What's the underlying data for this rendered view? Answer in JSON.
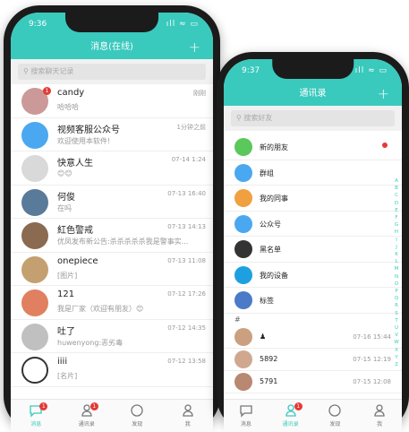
{
  "left_phone": {
    "status": {
      "time": "9:36",
      "signals": "ıll ≈ ▭"
    },
    "header": {
      "title": "消息(在线)",
      "add_label": "+"
    },
    "search": {
      "placeholder": "搜索聊天记录"
    },
    "conversations": [
      {
        "name": "candy",
        "message": "哈哈哈",
        "time": "刚刚",
        "badge": "1",
        "avatar_color": "#c99",
        "avatar": "person-photo"
      },
      {
        "name": "视频客服公众号",
        "message": "欢迎使用本软件!",
        "time": "1分钟之前",
        "badge": "",
        "avatar_color": "#4aa8f0",
        "avatar": "megaphone-icon"
      },
      {
        "name": "快意人生",
        "message": "😊😊",
        "time": "07-14 1:24",
        "badge": "",
        "avatar_color": "#d9d9d9",
        "avatar": "default-avatar"
      },
      {
        "name": "何俊",
        "message": "在吗",
        "time": "07-13 16:40",
        "badge": "",
        "avatar_color": "#5a7a9a",
        "avatar": "person-photo"
      },
      {
        "name": "紅色警戒",
        "message": "优凤发布新公告:杀杀杀杀杀我是警事实...",
        "time": "07-13 14:13",
        "badge": "",
        "avatar_color": "#8a6a50",
        "avatar": "group-photo"
      },
      {
        "name": "onepiece",
        "message": "[图片]",
        "time": "07-13 11:08",
        "badge": "",
        "avatar_color": "#c4a070",
        "avatar": "cartoon-avatar"
      },
      {
        "name": "121",
        "message": "我是厂家（欢迎有朋友）😊",
        "time": "07-12 17:26",
        "badge": "",
        "avatar_color": "#e08060",
        "avatar": "group-photo"
      },
      {
        "name": "吐了",
        "message": "huwenyong:恶劣毒",
        "time": "07-12 14:35",
        "badge": "",
        "avatar_color": "#c0c0c0",
        "avatar": "group-avatar"
      },
      {
        "name": "iiii",
        "message": "[名片]",
        "time": "07-12 13:58",
        "badge": "",
        "avatar_color": "#ffffff",
        "avatar": "smiley-icon"
      }
    ],
    "tabs": [
      {
        "label": "消息",
        "badge": "1",
        "icon": "chat-icon",
        "active": true
      },
      {
        "label": "通讯录",
        "badge": "1",
        "icon": "contacts-icon",
        "active": false
      },
      {
        "label": "发现",
        "badge": "",
        "icon": "compass-icon",
        "active": false
      },
      {
        "label": "我",
        "badge": "",
        "icon": "user-icon",
        "active": false
      }
    ]
  },
  "right_phone": {
    "status": {
      "time": "9:37",
      "signals": "ıll ≈ ▭"
    },
    "header": {
      "title": "通讯录",
      "add_label": "+"
    },
    "search": {
      "placeholder": "搜索好友"
    },
    "menu": [
      {
        "label": "新的朋友",
        "color": "#5ac85a",
        "icon": "new-friend-icon",
        "badge": true
      },
      {
        "label": "群组",
        "color": "#4aa8f0",
        "icon": "group-icon",
        "badge": false
      },
      {
        "label": "我的同事",
        "color": "#f0a040",
        "icon": "colleagues-icon",
        "badge": false
      },
      {
        "label": "公众号",
        "color": "#4aa8f0",
        "icon": "megaphone-icon",
        "badge": false
      },
      {
        "label": "黑名单",
        "color": "#333333",
        "icon": "blacklist-icon",
        "badge": false
      },
      {
        "label": "我的设备",
        "color": "#1ea0e0",
        "icon": "device-icon",
        "badge": false
      },
      {
        "label": "标签",
        "color": "#4a7ac8",
        "icon": "tag-icon",
        "badge": false
      }
    ],
    "section": "#",
    "contacts": [
      {
        "name": "♟",
        "time": "07-16 15:44",
        "avatar_color": "#caa080"
      },
      {
        "name": "5892",
        "time": "07-15 12:19",
        "avatar_color": "#d0a890"
      },
      {
        "name": "5791",
        "time": "07-15 12:08",
        "avatar_color": "#b88870"
      }
    ],
    "alphabet": [
      "A",
      "B",
      "C",
      "D",
      "E",
      "F",
      "G",
      "H",
      "I",
      "J",
      "K",
      "L",
      "M",
      "N",
      "O",
      "P",
      "Q",
      "R",
      "S",
      "T",
      "U",
      "V",
      "W",
      "X",
      "Y",
      "Z"
    ],
    "tabs": [
      {
        "label": "消息",
        "badge": "",
        "icon": "chat-icon",
        "active": false
      },
      {
        "label": "通讯录",
        "badge": "1",
        "icon": "contacts-icon",
        "active": true
      },
      {
        "label": "发现",
        "badge": "",
        "icon": "compass-icon",
        "active": false
      },
      {
        "label": "我",
        "badge": "",
        "icon": "user-icon",
        "active": false
      }
    ]
  }
}
